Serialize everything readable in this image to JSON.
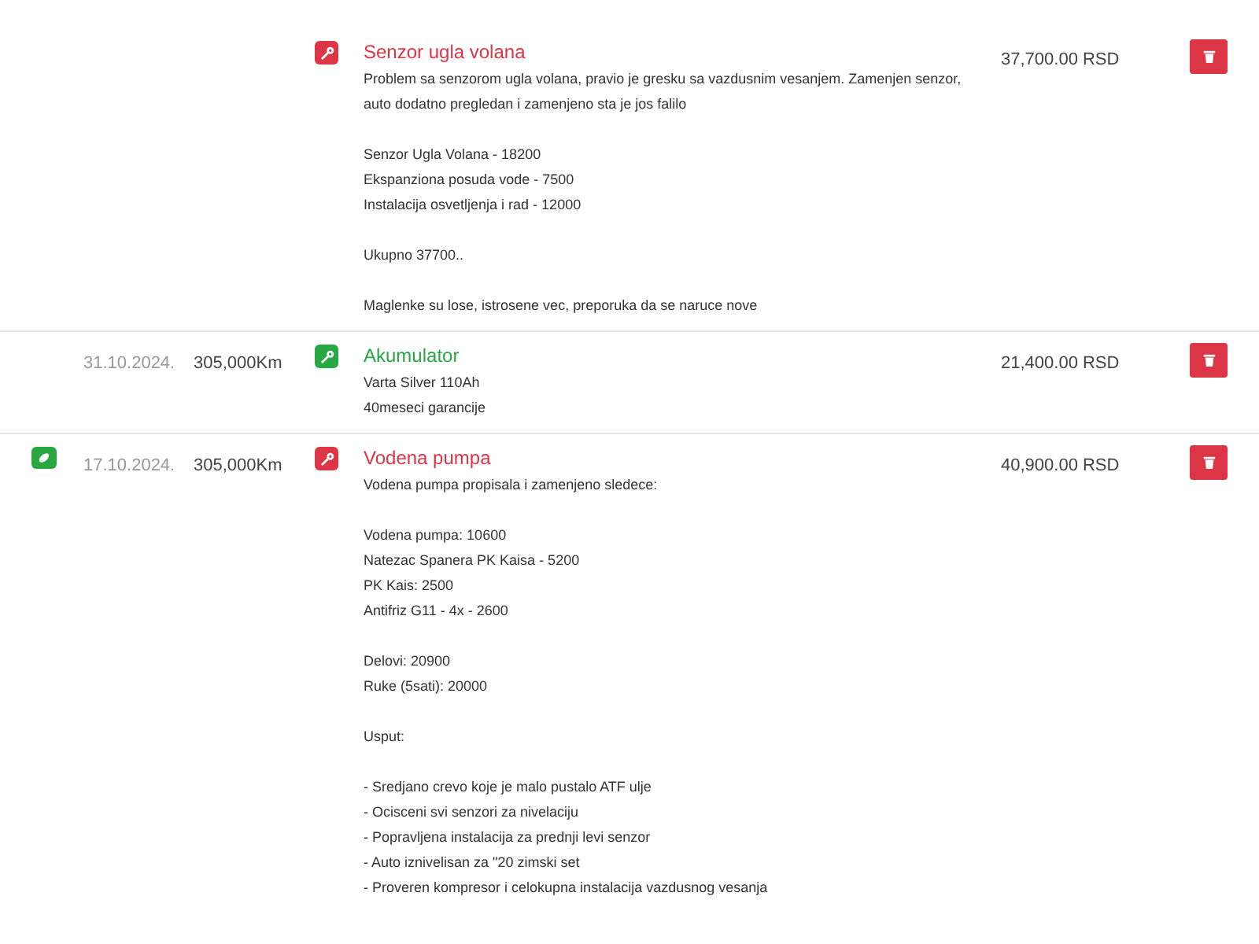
{
  "entries": [
    {
      "flagged": false,
      "color": "#dc3545",
      "title": "Senzor ugla volana",
      "paragraphs": [
        [
          "Problem sa senzorom ugla volana, pravio je gresku sa vazdusnim vesanjem. Zamenjen senzor, auto dodatno pregledan i zamenjeno sta je jos falilo"
        ],
        [
          "Senzor Ugla Volana - 18200",
          "Ekspanziona posuda vode - 7500",
          "Instalacija osvetljenja i rad - 12000"
        ],
        [
          "Ukupno 37700.."
        ],
        [
          "Maglenke su lose, istrosene vec, preporuka da se naruce nove"
        ]
      ],
      "price": "37,700.00 RSD"
    },
    {
      "flagged": false,
      "date": "31.10.2024.",
      "km": "305,000Km",
      "color": "#28a745",
      "title": "Akumulator",
      "paragraphs": [
        [
          "Varta Silver 110Ah",
          "40meseci garancije"
        ]
      ],
      "price": "21,400.00 RSD"
    },
    {
      "flagged": true,
      "date": "17.10.2024.",
      "km": "305,000Km",
      "color": "#dc3545",
      "title": "Vodena pumpa",
      "paragraphs": [
        [
          "Vodena pumpa propisala i zamenjeno sledece:"
        ],
        [
          "Vodena pumpa: 10600",
          "Natezac Spanera PK Kaisa - 5200",
          "PK Kais: 2500",
          "Antifriz G11 - 4x - 2600"
        ],
        [
          "Delovi: 20900",
          "Ruke (5sati): 20000"
        ],
        [
          "Usput:"
        ],
        [
          "- Sredjano crevo koje je malo pustalo ATF ulje",
          "- Ocisceni svi senzori za nivelaciju",
          "- Popravljena instalacija za prednji levi senzor",
          "- Auto iznivelisan za \"20 zimski set",
          "- Proveren kompresor i celokupna instalacija vazdusnog vesanja"
        ]
      ],
      "price": "40,900.00 RSD"
    }
  ]
}
